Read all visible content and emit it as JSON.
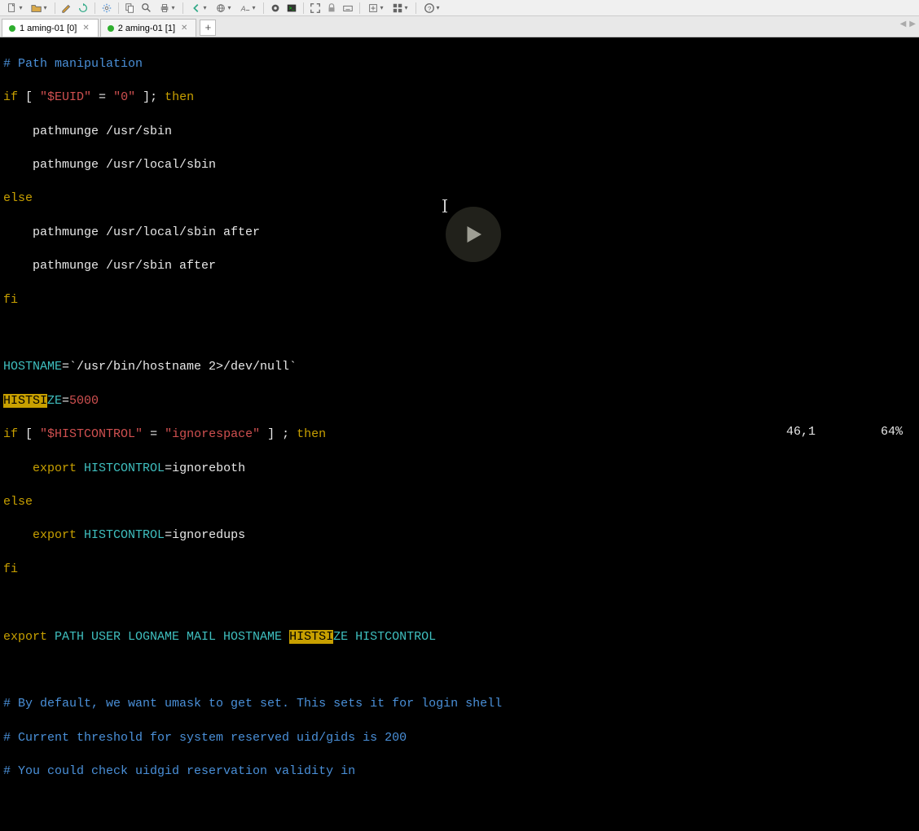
{
  "tabs": [
    {
      "label": "1 aming-01 [0]",
      "active": true
    },
    {
      "label": "2 aming-01 [1]",
      "active": false
    }
  ],
  "code": {
    "l1_comment": "# Path manipulation",
    "l2_if": "if",
    "l2_bracket_open": " [ ",
    "l2_euid": "\"$EUID\"",
    "l2_eq": " = ",
    "l2_zero": "\"0\"",
    "l2_bracket_close": " ]; ",
    "l2_then": "then",
    "l3": "    pathmunge /usr/sbin",
    "l4": "    pathmunge /usr/local/sbin",
    "l5_else": "else",
    "l6_a": "    pathmunge /usr/local/sbin ",
    "l6_b": "after",
    "l7_a": "    pathmunge /usr/sbin ",
    "l7_b": "after",
    "l8_fi": "fi",
    "l10_a": "HOSTNAME",
    "l10_b": "=`/usr/bin/hostname 2>/dev/null`",
    "l11_hl": "HISTSI",
    "l11_a": "ZE",
    "l11_eq": "=",
    "l11_b": "5000",
    "l12_if": "if",
    "l12_bo": " [ ",
    "l12_var": "\"$HISTCONTROL\"",
    "l12_eq": " = ",
    "l12_str": "\"ignorespace\"",
    "l12_bc": " ] ; ",
    "l12_then": "then",
    "l13_a": "    ",
    "l13_exp": "export",
    "l13_b": " HISTCONTROL",
    "l13_c": "=ignoreboth",
    "l14_else": "else",
    "l15_a": "    ",
    "l15_exp": "export",
    "l15_b": " HISTCONTROL",
    "l15_c": "=ignoredups",
    "l16_fi": "fi",
    "l18_exp": "export",
    "l18_a": " PATH USER LOGNAME MAIL HOSTNAME ",
    "l18_hl": "HISTSI",
    "l18_b": "ZE HISTCONTROL",
    "l20": "# By default, we want umask to get set. This sets it for login shell",
    "l21": "# Current threshold for system reserved uid/gids is 200",
    "l22": "# You could check uidgid reservation validity in"
  },
  "status": {
    "pos": "46,1",
    "pct": "64%"
  }
}
